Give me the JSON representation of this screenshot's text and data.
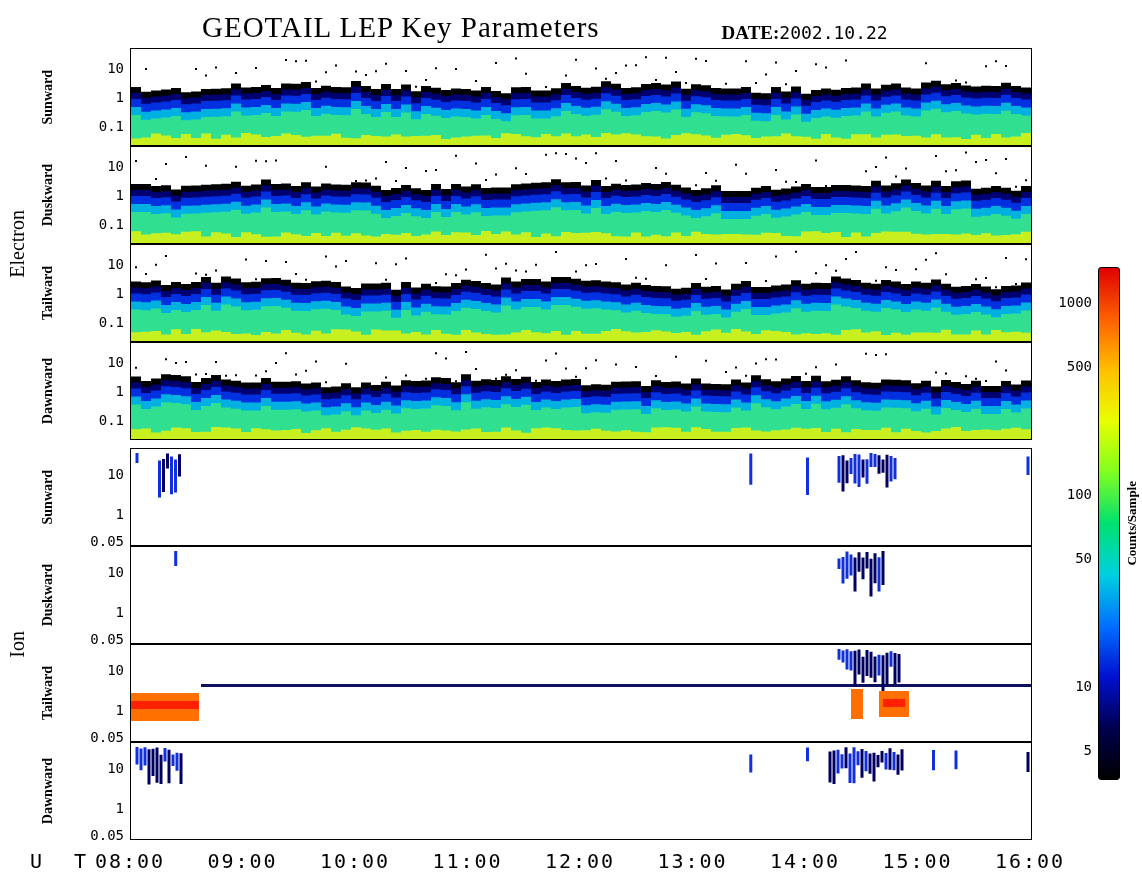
{
  "title": "GEOTAIL LEP Key Parameters",
  "date": {
    "label": "DATE:",
    "value": "2002.10.22"
  },
  "groups": [
    {
      "kind": "electron",
      "name": "Electron",
      "panels": [
        {
          "name": "Sunward",
          "y_ticks": [
            "10",
            "1",
            "0.1"
          ]
        },
        {
          "name": "Duskward",
          "y_ticks": [
            "10",
            "1",
            "0.1"
          ]
        },
        {
          "name": "Tailward",
          "y_ticks": [
            "10",
            "1",
            "0.1"
          ]
        },
        {
          "name": "Dawnward",
          "y_ticks": [
            "10",
            "1",
            "0.1"
          ]
        }
      ]
    },
    {
      "kind": "ion",
      "name": "Ion",
      "panels": [
        {
          "name": "Sunward",
          "y_ticks": [
            "10",
            "1",
            "0.05"
          ]
        },
        {
          "name": "Duskward",
          "y_ticks": [
            "10",
            "1",
            "0.05"
          ]
        },
        {
          "name": "Tailward",
          "y_ticks": [
            "10",
            "1",
            "0.05"
          ]
        },
        {
          "name": "Dawnward",
          "y_ticks": [
            "10",
            "1",
            "0.05"
          ]
        }
      ]
    }
  ],
  "colorbar": {
    "title": "Counts/Sample",
    "ticks": [
      "1000",
      "500",
      "100",
      "50",
      "10",
      "5"
    ]
  },
  "x_axis": {
    "label": "U T",
    "ticks": [
      "08:00",
      "09:00",
      "10:00",
      "11:00",
      "12:00",
      "13:00",
      "14:00",
      "15:00",
      "16:00"
    ]
  }
}
